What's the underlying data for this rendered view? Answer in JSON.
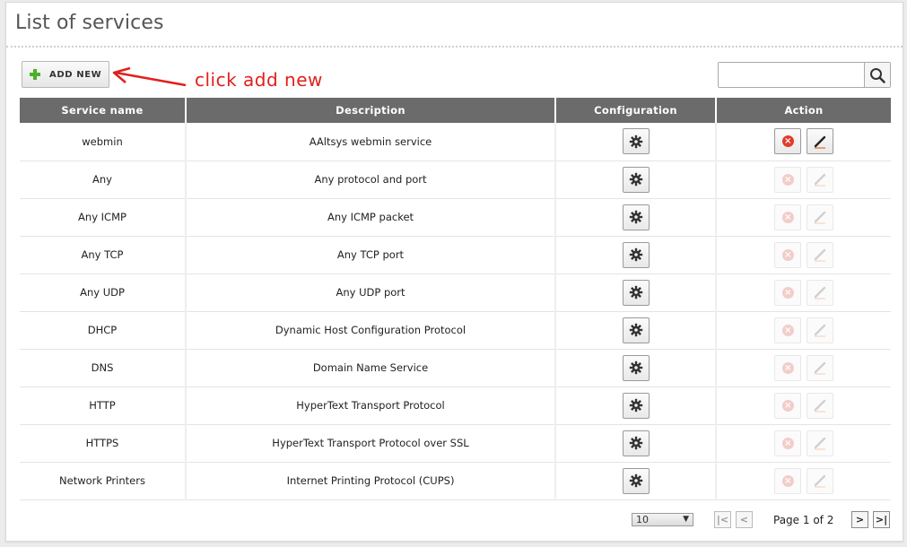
{
  "page": {
    "title": "List of services"
  },
  "toolbar": {
    "add_new_label": "ADD NEW"
  },
  "annotation": {
    "text": "click add new"
  },
  "search": {
    "value": ""
  },
  "table": {
    "headers": [
      "Service name",
      "Description",
      "Configuration",
      "Action"
    ],
    "rows": [
      {
        "name": "webmin",
        "description": "AAltsys webmin service",
        "actions_enabled": true
      },
      {
        "name": "Any",
        "description": "Any protocol and port",
        "actions_enabled": false
      },
      {
        "name": "Any ICMP",
        "description": "Any ICMP packet",
        "actions_enabled": false
      },
      {
        "name": "Any TCP",
        "description": "Any TCP port",
        "actions_enabled": false
      },
      {
        "name": "Any UDP",
        "description": "Any UDP port",
        "actions_enabled": false
      },
      {
        "name": "DHCP",
        "description": "Dynamic Host Configuration Protocol",
        "actions_enabled": false
      },
      {
        "name": "DNS",
        "description": "Domain Name Service",
        "actions_enabled": false
      },
      {
        "name": "HTTP",
        "description": "HyperText Transport Protocol",
        "actions_enabled": false
      },
      {
        "name": "HTTPS",
        "description": "HyperText Transport Protocol over SSL",
        "actions_enabled": false
      },
      {
        "name": "Network Printers",
        "description": "Internet Printing Protocol (CUPS)",
        "actions_enabled": false
      }
    ]
  },
  "pager": {
    "page_size": "10",
    "page_label": "Page 1 of 2",
    "first_icon": "first-page-icon",
    "prev_icon": "prev-page-icon",
    "next_icon": "next-page-icon",
    "last_icon": "last-page-icon"
  },
  "icons": {
    "config": "gear-icon",
    "delete": "delete-icon",
    "edit": "pencil-icon",
    "add": "plus-icon",
    "search": "search-icon"
  },
  "colors": {
    "header_bg": "#6b6b6b",
    "annotation": "#e0201c",
    "add_icon": "#4caf2a",
    "delete_icon": "#e23b2b"
  }
}
